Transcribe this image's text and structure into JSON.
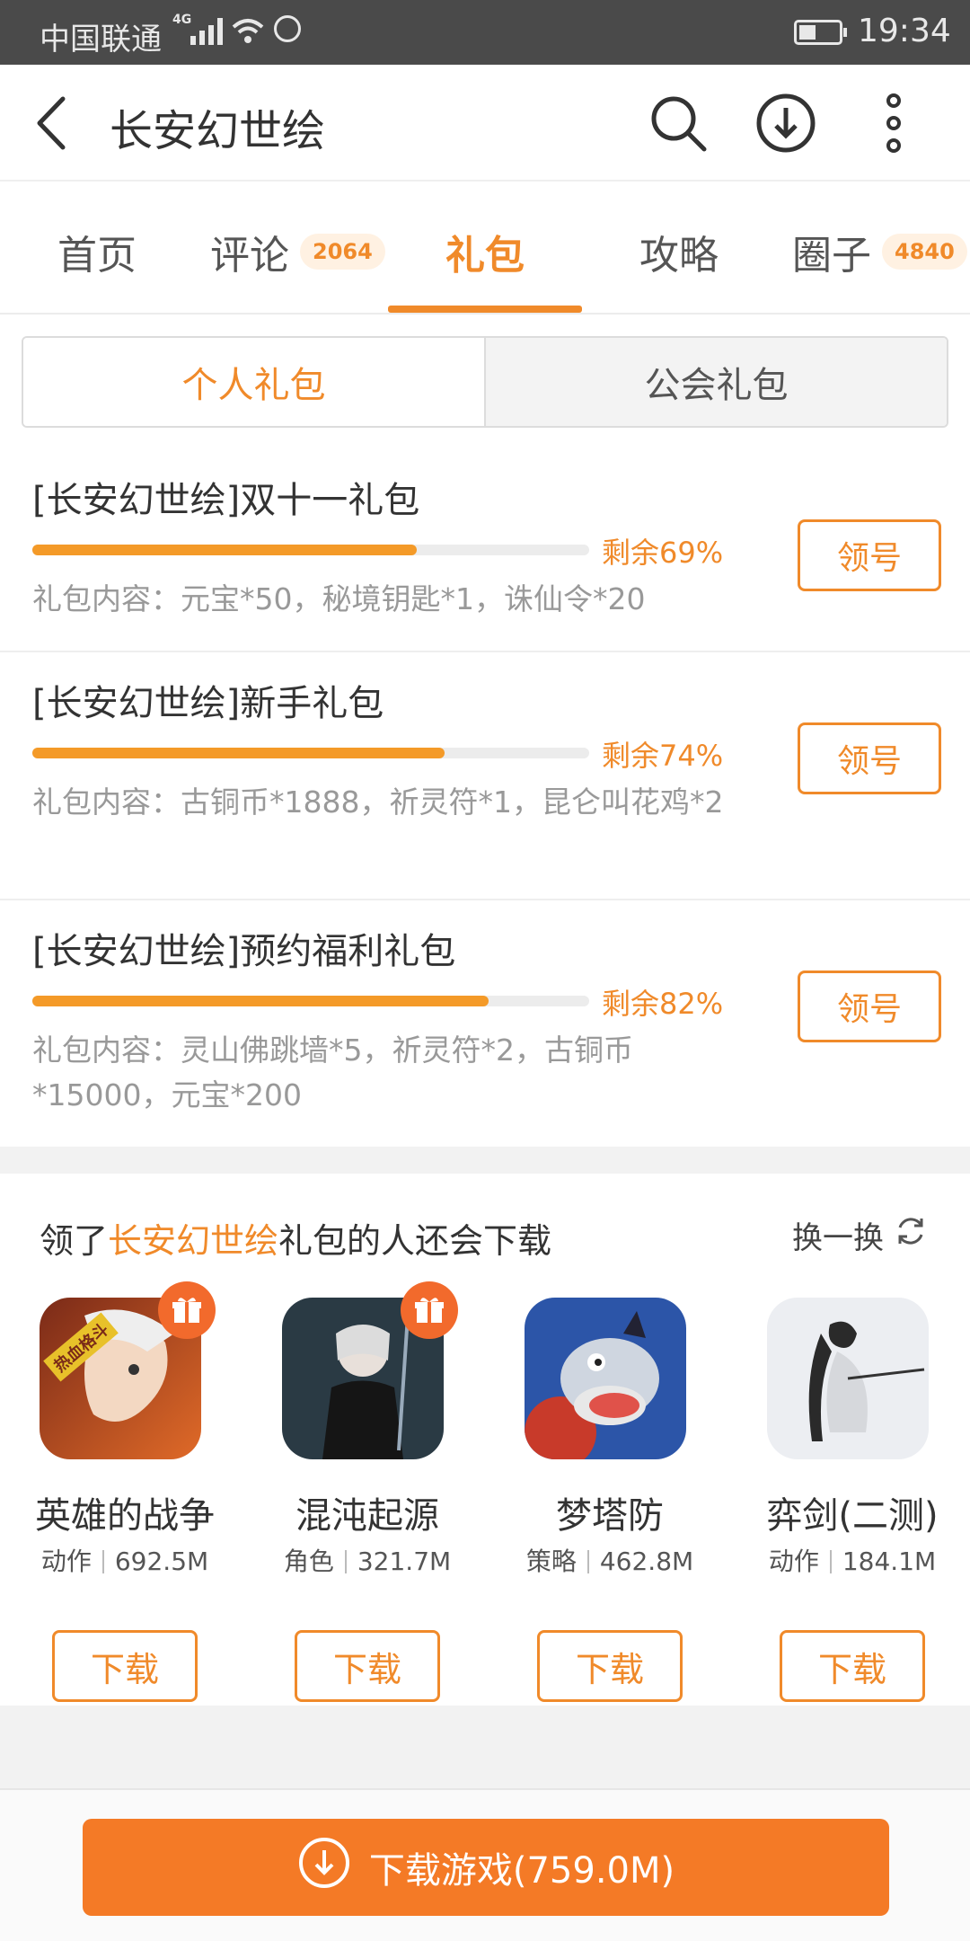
{
  "status_bar": {
    "carrier": "中国联通",
    "network": "4G",
    "time": "19:34",
    "icons": [
      "signal-icon",
      "wifi-icon",
      "face-icon",
      "battery-icon"
    ]
  },
  "header": {
    "title": "长安幻世绘",
    "icons": [
      "back-arrow-icon",
      "search-icon",
      "download-icon",
      "more-vertical-icon"
    ]
  },
  "tabs": [
    {
      "label": "首页",
      "badge": ""
    },
    {
      "label": "评论",
      "badge": "2064"
    },
    {
      "label": "礼包",
      "badge": "",
      "active": true
    },
    {
      "label": "攻略",
      "badge": ""
    },
    {
      "label": "圈子",
      "badge": "4840"
    }
  ],
  "segment": {
    "personal": "个人礼包",
    "guild": "公会礼包",
    "selected": "个人礼包"
  },
  "gifts": [
    {
      "name": "[长安幻世绘]双十一礼包",
      "remaining_label": "剩余69%",
      "remaining": 0.69,
      "content": "礼包内容：元宝*50，秘境钥匙*1，诛仙令*20",
      "button": "领号"
    },
    {
      "name": "[长安幻世绘]新手礼包",
      "remaining_label": "剩余74%",
      "remaining": 0.74,
      "content": "礼包内容：古铜币*1888，祈灵符*1，昆仑叫花鸡*2",
      "button": "领号"
    },
    {
      "name": "[长安幻世绘]预约福利礼包",
      "remaining_label": "剩余82%",
      "remaining": 0.82,
      "content": "礼包内容：灵山佛跳墙*5，祈灵符*2，古铜币*15000，元宝*200",
      "button": "领号"
    }
  ],
  "recommend": {
    "prefix": "领了",
    "highlight": "长安幻世绘",
    "suffix": "礼包的人还会下载",
    "refresh": "换一换",
    "apps": [
      {
        "name": "英雄的战争",
        "category": "动作",
        "size": "692.5M",
        "button": "下载",
        "has_gift": true,
        "icon_label": "热血格斗"
      },
      {
        "name": "混沌起源",
        "category": "角色",
        "size": "321.7M",
        "button": "下载",
        "has_gift": true
      },
      {
        "name": "梦塔防",
        "category": "策略",
        "size": "462.8M",
        "button": "下载",
        "has_gift": false
      },
      {
        "name": "弈剑(二测)",
        "category": "动作",
        "size": "184.1M",
        "button": "下载",
        "has_gift": false
      }
    ]
  },
  "bottom": {
    "download_label": "下载游戏(759.0M)"
  },
  "colors": {
    "accent": "#f08a2a",
    "button": "#f47a26",
    "status_bar": "#4a4a4a"
  }
}
